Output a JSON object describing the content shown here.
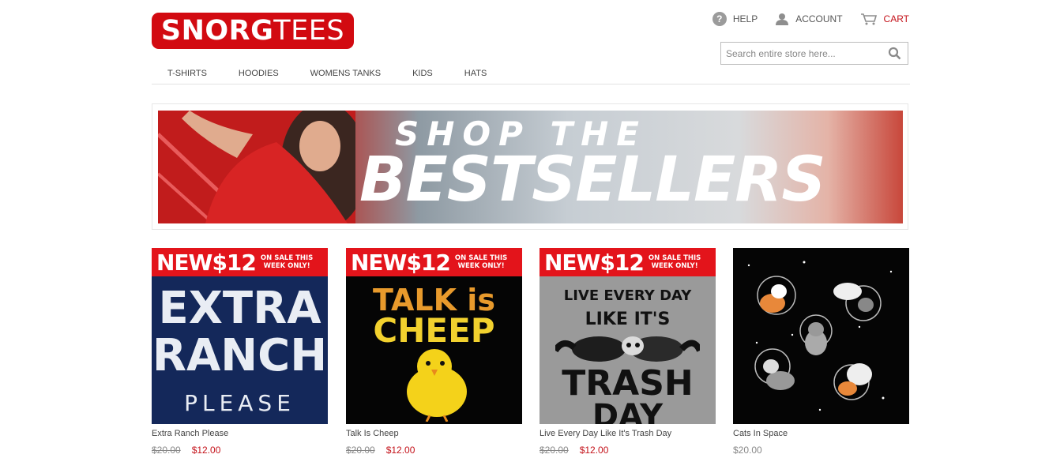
{
  "brand": {
    "logo_bold": "SNORG",
    "logo_light": "TEES"
  },
  "header": {
    "help": "HELP",
    "account": "ACCOUNT",
    "cart": "CART",
    "search_placeholder": "Search entire store here..."
  },
  "nav": [
    "T-SHIRTS",
    "HOODIES",
    "WOMENS TANKS",
    "KIDS",
    "HATS"
  ],
  "banner": {
    "line1": "SHOP THE",
    "line2": "BESTSELLERS"
  },
  "sale_badge": {
    "label": "NEW$12",
    "note_line1": "ON SALE THIS",
    "note_line2": "WEEK ONLY!"
  },
  "products": [
    {
      "name": "Extra Ranch Please",
      "old_price": "$20.00",
      "price": "$12.00",
      "art": [
        "EXTRA",
        "RANCH",
        "PLEASE"
      ]
    },
    {
      "name": "Talk Is Cheep",
      "old_price": "$20.00",
      "price": "$12.00",
      "art": [
        "TALK is",
        "CHEEP"
      ]
    },
    {
      "name": "Live Every Day Like It's Trash Day",
      "old_price": "$20.00",
      "price": "$12.00",
      "art": [
        "LIVE EVERY DAY",
        "LIKE IT'S",
        "TRASH",
        "DAY"
      ]
    },
    {
      "name": "Cats In Space",
      "price": "$20.00"
    }
  ],
  "colors": {
    "brand_red": "#d20a11",
    "price_red": "#c4121a"
  }
}
